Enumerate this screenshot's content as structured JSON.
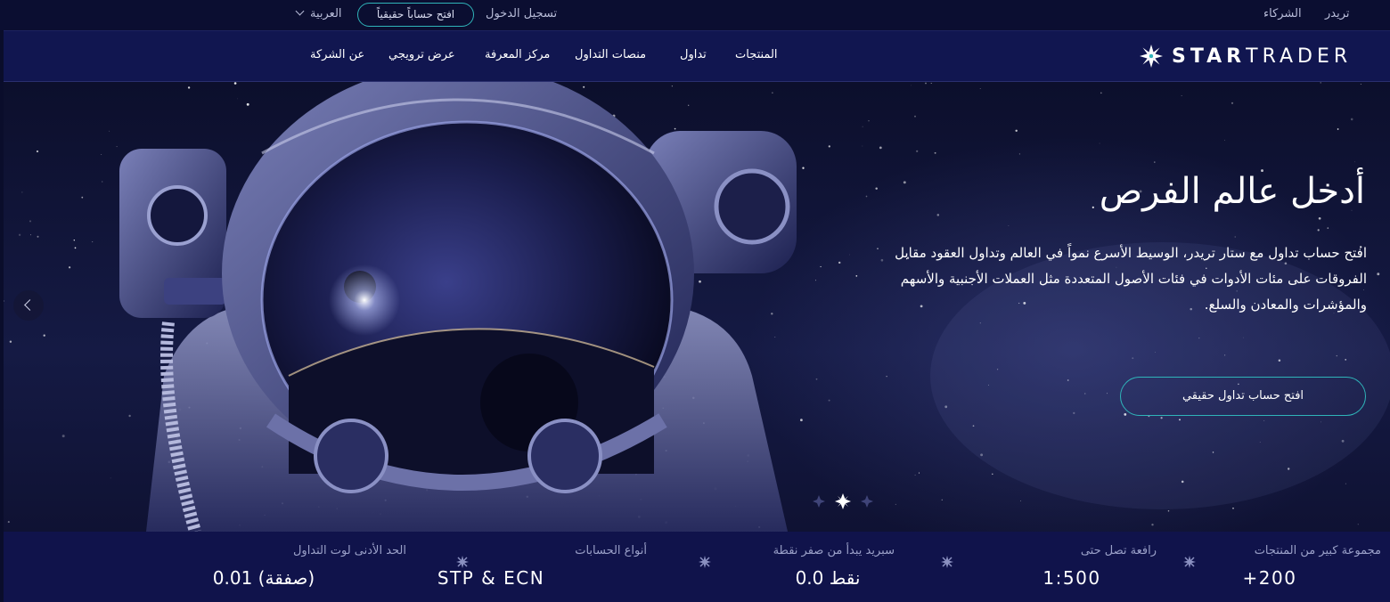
{
  "topbar": {
    "partners_label": "الشركاء",
    "trader_label": "تريدر",
    "login_label": "تسجيل الدخول",
    "open_live_label": "افتح حساباً حقيقياً",
    "language_label": "العربية"
  },
  "nav": {
    "logo_bold": "STAR",
    "logo_regular": "TRADER",
    "items": [
      {
        "label": "المنتجات"
      },
      {
        "label": "تداول"
      },
      {
        "label": "منصات التداول"
      },
      {
        "label": "مركز المعرفة"
      },
      {
        "label": "عرض ترويجي"
      },
      {
        "label": "عن الشركة"
      }
    ]
  },
  "hero": {
    "title": "أدخل عالم الفرص",
    "description": "افتح حساب تداول مع ستار تريدر، الوسيط الأسرع نمواً في العالم وتداول العقود مقابل الفروقات على مئات الأدوات في فئات الأصول المتعددة مثل العملات الأجنبية والأسهم والمؤشرات والمعادن والسلع.",
    "cta_label": "افتح حساب تداول حقيقي"
  },
  "stats": [
    {
      "label": "مجموعة كبير من المنتجات",
      "value": "+200"
    },
    {
      "label": "رافعة تصل حتى",
      "value": "1:500"
    },
    {
      "label": "سبريد يبدأ من صفر نقطة",
      "value": "0.0 نقط"
    },
    {
      "label": "أنواع الحسابات",
      "value": "STP & ECN"
    },
    {
      "label": "الحد الأدنى لوت التداول",
      "value": "0.01 (صفقة)"
    }
  ],
  "colors": {
    "accent": "#2fb4b9",
    "navy": "#111650",
    "stats_bg": "#10134b"
  }
}
